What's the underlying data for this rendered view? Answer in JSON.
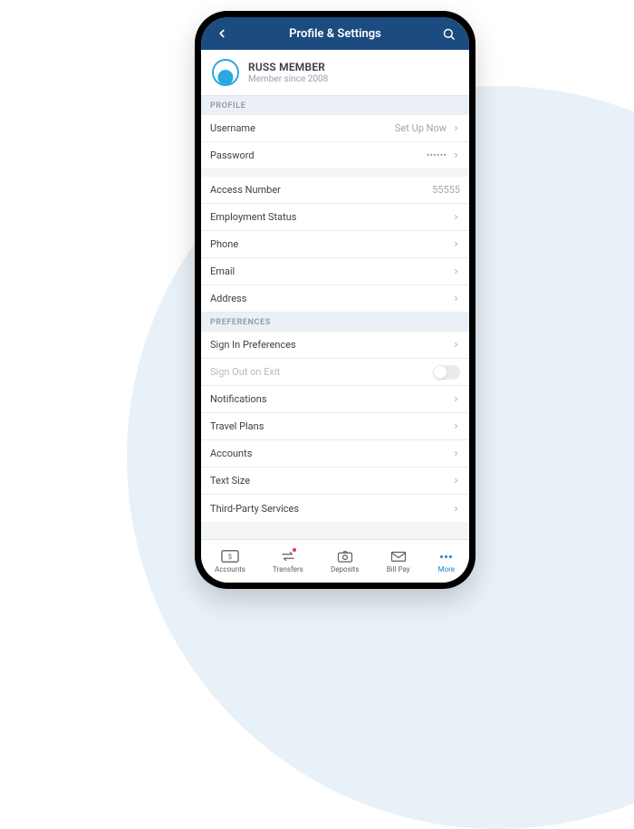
{
  "header": {
    "title": "Profile & Settings"
  },
  "member": {
    "name": "RUSS MEMBER",
    "since": "Member since 2008"
  },
  "sections": {
    "profile": {
      "header": "PROFILE",
      "username_label": "Username",
      "username_value": "Set Up Now",
      "password_label": "Password",
      "password_value": "••••••",
      "access_label": "Access Number",
      "access_value": "55555",
      "employment_label": "Employment Status",
      "phone_label": "Phone",
      "email_label": "Email",
      "address_label": "Address"
    },
    "preferences": {
      "header": "PREFERENCES",
      "signin_label": "Sign In Preferences",
      "signout_label": "Sign Out on Exit",
      "notifications_label": "Notifications",
      "travel_label": "Travel Plans",
      "accounts_label": "Accounts",
      "textsize_label": "Text Size",
      "thirdparty_label": "Third-Party Services"
    }
  },
  "tabs": {
    "accounts": "Accounts",
    "transfers": "Transfers",
    "deposits": "Deposits",
    "billpay": "Bill Pay",
    "more": "More"
  }
}
